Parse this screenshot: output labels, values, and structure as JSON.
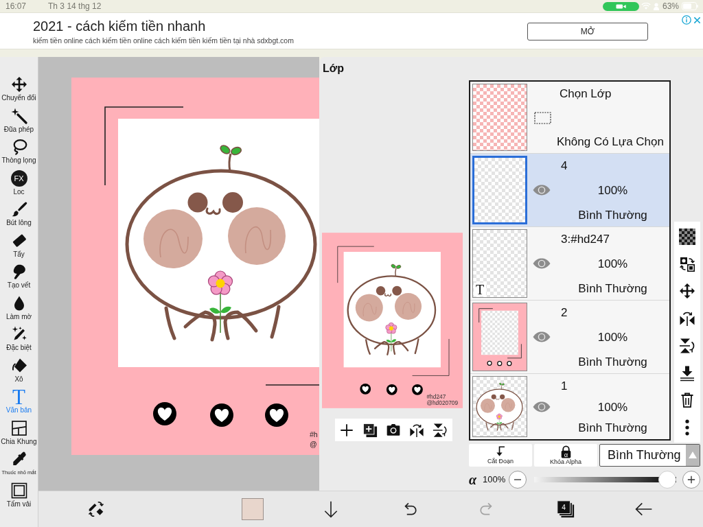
{
  "status_bar": {
    "time": "16:07",
    "date": "Th 3 14 thg 12",
    "battery": "63%"
  },
  "ad": {
    "title": "2021 - cách kiếm tiền nhanh",
    "description": "kiếm tiền online cách kiếm tiền online cách kiếm tiền kiếm tiền tại nhà sdxbgt.com",
    "button": "MỞ"
  },
  "tools": [
    {
      "label": "Chuyển đổi",
      "selected": false
    },
    {
      "label": "Đũa phép",
      "selected": false
    },
    {
      "label": "Thòng lọng",
      "selected": false
    },
    {
      "label": "Loc",
      "glyph": "FX",
      "selected": false
    },
    {
      "label": "Bút lông",
      "selected": false
    },
    {
      "label": "Tẩy",
      "selected": false
    },
    {
      "label": "Tạo vết",
      "selected": false
    },
    {
      "label": "Làm mờ",
      "selected": false
    },
    {
      "label": "Đặc biệt",
      "selected": false
    },
    {
      "label": "Xô",
      "selected": false
    },
    {
      "label": "Văn bản",
      "glyph": "T",
      "selected": true
    },
    {
      "label": "Chia Khung",
      "selected": false
    },
    {
      "label": "Thuốc nhỏ mắt",
      "selected": false
    },
    {
      "label": "Tấm vải",
      "selected": false
    }
  ],
  "canvas": {
    "caption": [
      "#h",
      "@"
    ]
  },
  "layer_panel": {
    "title": "Lớp",
    "preview": {
      "caption": [
        "#hd247",
        "@hd020709"
      ]
    },
    "selection_layer": {
      "title": "Chọn Lớp",
      "status": "Không Có Lựa Chọn"
    },
    "layers": [
      {
        "kind": "empty",
        "name": "4",
        "opacity": "100%",
        "blend": "Bình Thường",
        "visible": true,
        "selected": true
      },
      {
        "kind": "text",
        "badge": "T",
        "name": "3:#hd247",
        "opacity": "100%",
        "blend": "Bình Thường",
        "visible": true,
        "selected": false
      },
      {
        "kind": "frame",
        "name": "2",
        "opacity": "100%",
        "blend": "Bình Thường",
        "visible": true,
        "selected": false
      },
      {
        "kind": "artwork",
        "name": "1",
        "opacity": "100%",
        "blend": "Bình Thường",
        "visible": true,
        "selected": false
      }
    ],
    "clip_button": "Cắt Đoạn",
    "alpha_lock": {
      "glyph": "α",
      "label": "Khóa Alpha"
    },
    "blend_mode": "Bình Thường",
    "opacity": {
      "symbol": "α",
      "reading": "100%",
      "level": 1
    }
  },
  "bottom_bar": {
    "actions": [
      {
        "kind": "swap",
        "disabled": false
      },
      {
        "kind": "color",
        "disabled": false
      },
      {
        "kind": "down",
        "disabled": false
      },
      {
        "kind": "undo",
        "disabled": false
      },
      {
        "kind": "redo",
        "disabled": true
      },
      {
        "kind": "layers",
        "count": "4",
        "disabled": false
      },
      {
        "kind": "back",
        "disabled": false
      }
    ]
  }
}
